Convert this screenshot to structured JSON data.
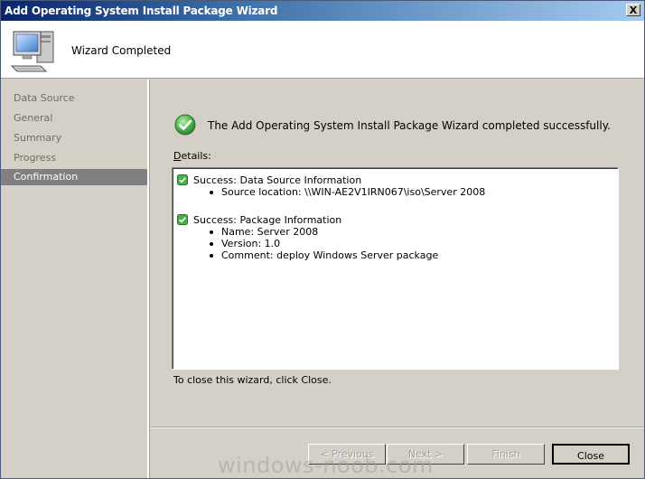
{
  "window": {
    "title": "Add Operating System Install Package Wizard",
    "close_symbol": "X"
  },
  "header": {
    "title": "Wizard Completed",
    "icon": "computer-icon"
  },
  "sidebar": {
    "items": [
      {
        "label": "Data Source",
        "active": false
      },
      {
        "label": "General",
        "active": false
      },
      {
        "label": "Summary",
        "active": false
      },
      {
        "label": "Progress",
        "active": false
      },
      {
        "label": "Confirmation",
        "active": true
      }
    ]
  },
  "main": {
    "success_message": "The Add Operating System Install Package Wizard completed successfully.",
    "details_label_mnemonic": "D",
    "details_label_rest": "etails:",
    "details": [
      {
        "title": "Success: Data Source Information",
        "items": [
          "Source location: \\\\WIN-AE2V1IRN067\\iso\\Server 2008"
        ]
      },
      {
        "title": "Success: Package Information",
        "items": [
          "Name: Server 2008",
          "Version: 1.0",
          "Comment: deploy Windows Server package"
        ]
      }
    ],
    "close_hint": "To close this wizard, click Close."
  },
  "footer": {
    "previous_label": "< Previous",
    "next_label": "Next >",
    "finish_label": "Finish",
    "close_label": "Close"
  },
  "watermark": "windows-noob.com",
  "colors": {
    "titlebar_start": "#0a246a",
    "titlebar_end": "#a6caf0",
    "active_nav": "#808080",
    "success_green": "#3a9a3a"
  }
}
